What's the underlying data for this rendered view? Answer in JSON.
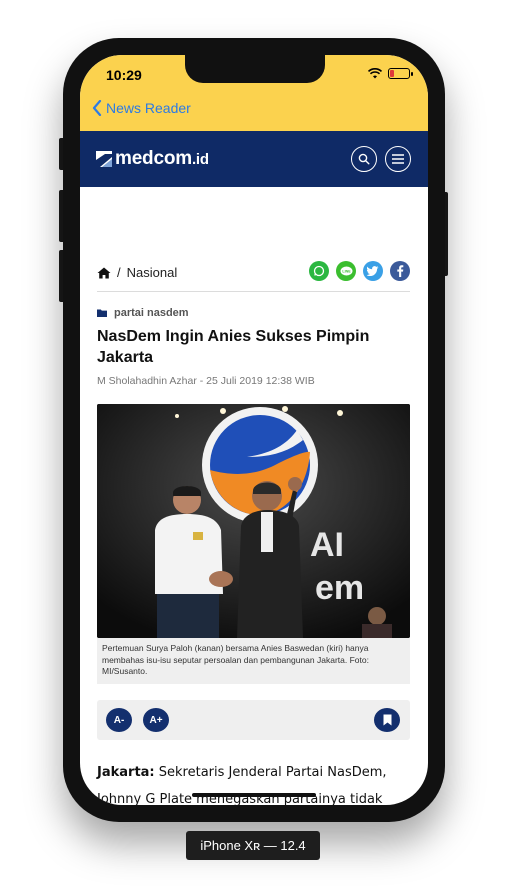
{
  "status_bar": {
    "time": "10:29"
  },
  "nav": {
    "back_label": "News Reader"
  },
  "site": {
    "logo_main": "medcom",
    "logo_suffix": ".id"
  },
  "breadcrumb": {
    "section": "Nasional",
    "separator": "/"
  },
  "share": [
    "whatsapp-icon",
    "line-icon",
    "twitter-icon",
    "facebook-icon"
  ],
  "article": {
    "tag": "partai nasdem",
    "title": "NasDem Ingin Anies Sukses Pimpin Jakarta",
    "byline": "M Sholahadhin Azhar - 25 Juli 2019 12:38 WIB",
    "caption": "Pertemuan Surya Paloh (kanan) bersama Anies Baswedan (kiri) hanya membahas isu-isu seputar persoalan dan pembangunan Jakarta. Foto: MI/Susanto.",
    "dateline": "Jakarta:",
    "body": " Sekretaris Jenderal Partai NasDem, Johnny G Plate menegaskan partainya tidak"
  },
  "tools": {
    "decrease": "A-",
    "increase": "A+"
  },
  "device_label": "iPhone Xʀ — 12.4",
  "colors": {
    "nav_yellow": "#fbd24e",
    "header_navy": "#0f2a66",
    "link_blue": "#2c7be5"
  }
}
